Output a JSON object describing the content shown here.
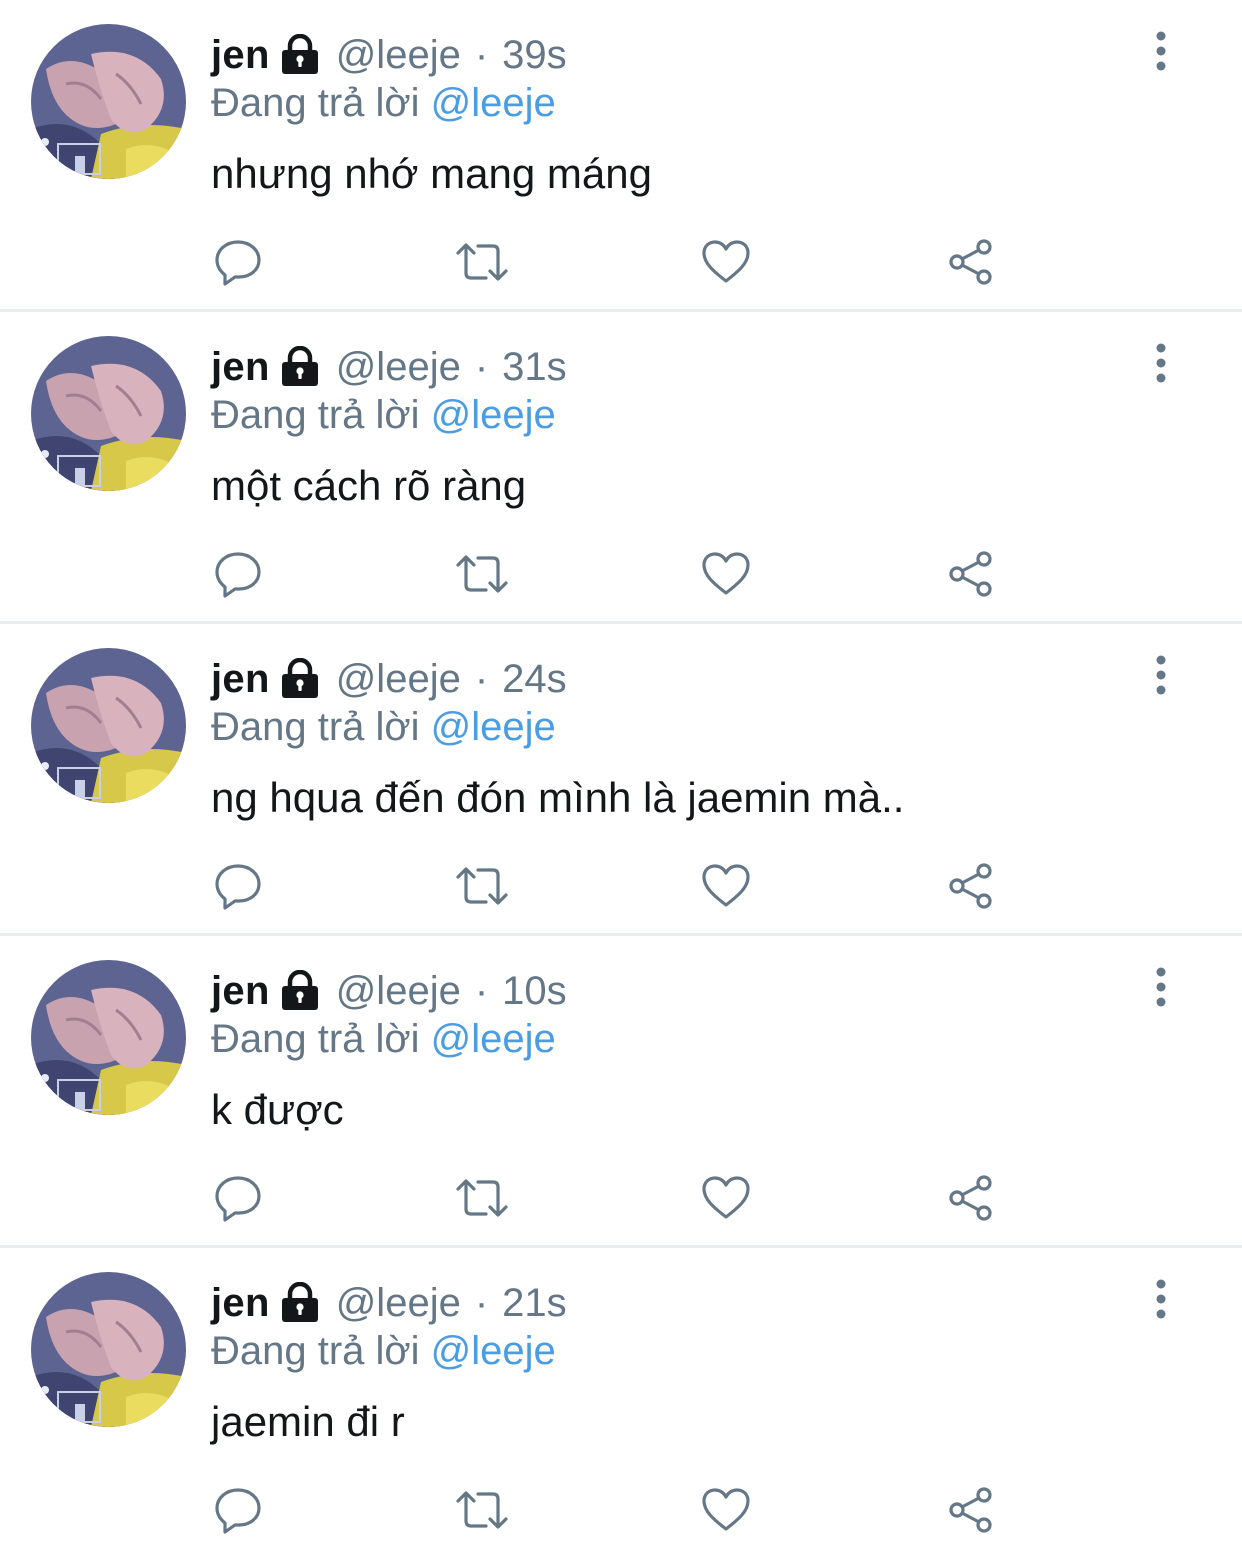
{
  "tweets": [
    {
      "name": "jen",
      "handle": "@leeje",
      "separator": "·",
      "time": "39s",
      "reply_prefix": "Đang trả lời",
      "reply_to": "@leeje",
      "text": "nhưng nhớ mang máng"
    },
    {
      "name": "jen",
      "handle": "@leeje",
      "separator": "·",
      "time": "31s",
      "reply_prefix": "Đang trả lời",
      "reply_to": "@leeje",
      "text": "một cách rõ ràng"
    },
    {
      "name": "jen",
      "handle": "@leeje",
      "separator": "·",
      "time": "24s",
      "reply_prefix": "Đang trả lời",
      "reply_to": "@leeje",
      "text": "ng hqua đến đón mình là jaemin mà.."
    },
    {
      "name": "jen",
      "handle": "@leeje",
      "separator": "·",
      "time": "10s",
      "reply_prefix": "Đang trả lời",
      "reply_to": "@leeje",
      "text": "k được"
    },
    {
      "name": "jen",
      "handle": "@leeje",
      "separator": "·",
      "time": "21s",
      "reply_prefix": "Đang trả lời",
      "reply_to": "@leeje",
      "text": "jaemin đi r"
    }
  ],
  "icons": {
    "lock": "lock-icon",
    "more": "more-vertical-icon",
    "reply": "reply-icon",
    "retweet": "retweet-icon",
    "like": "heart-icon",
    "share": "share-icon"
  },
  "colors": {
    "name": "#14171a",
    "secondary_text": "#657786",
    "mention": "#4a9de3",
    "icon": "#657786",
    "divider": "#e6ecf0",
    "background": "#ffffff"
  }
}
